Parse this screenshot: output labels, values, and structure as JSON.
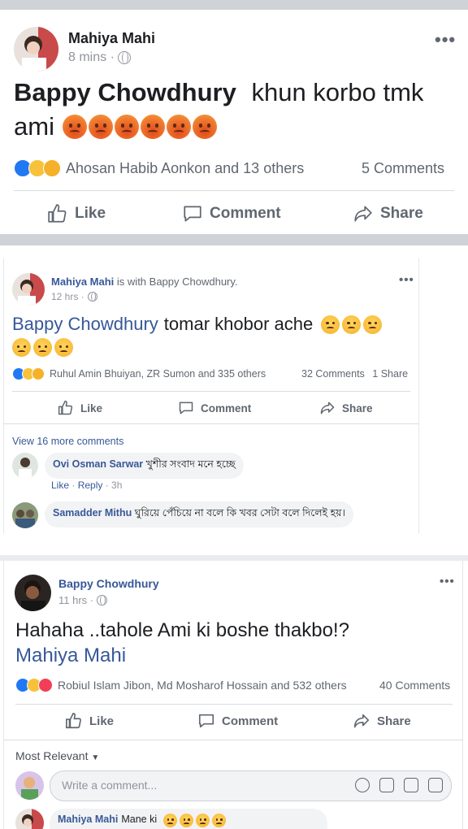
{
  "post1": {
    "author": "Mahiya Mahi",
    "time": "8 mins ·",
    "tag_name": "Bappy Chowdhury",
    "text_a": "khun korbo tmk",
    "text_b": "ami",
    "reactors": "Ahosan Habib Aonkon and 13 others",
    "counts": "5 Comments",
    "like": "Like",
    "comment": "Comment",
    "share": "Share"
  },
  "post2": {
    "author": "Mahiya Mahi",
    "with": "is with Bappy Chowdhury.",
    "time": "12 hrs ·",
    "tag_name": "Bappy Chowdhury",
    "text": "tomar khobor ache",
    "reactors": "Ruhul Amin Bhuiyan, ZR Sumon and 335 others",
    "comments_count": "32 Comments",
    "shares_count": "1 Share",
    "like": "Like",
    "comment": "Comment",
    "share": "Share",
    "view_more": "View 16 more comments",
    "comments": [
      {
        "name": "Ovi Osman Sarwar",
        "text": "খুশীর সংবাদ মনে হচ্ছে",
        "like": "Like",
        "reply": "Reply",
        "time": "3h"
      },
      {
        "name": "Samadder Mithu",
        "text": "ঘুরিয়ে পেঁচিয়ে না বলে কি খবর সেটা বলে দিলেই হয়।"
      }
    ]
  },
  "post3": {
    "author": "Bappy Chowdhury",
    "time": "11 hrs ·",
    "text": "Hahaha ..tahole Ami ki boshe thakbo!?",
    "tag_name": "Mahiya Mahi",
    "reactors": "Robiul Islam Jibon, Md Mosharof Hossain and 532 others",
    "counts": "40 Comments",
    "like": "Like",
    "comment": "Comment",
    "share": "Share",
    "most_relevant": "Most Relevant",
    "write_placeholder": "Write a comment...",
    "last_comment_name": "Mahiya Mahi",
    "last_comment_text": "Mane ki"
  }
}
